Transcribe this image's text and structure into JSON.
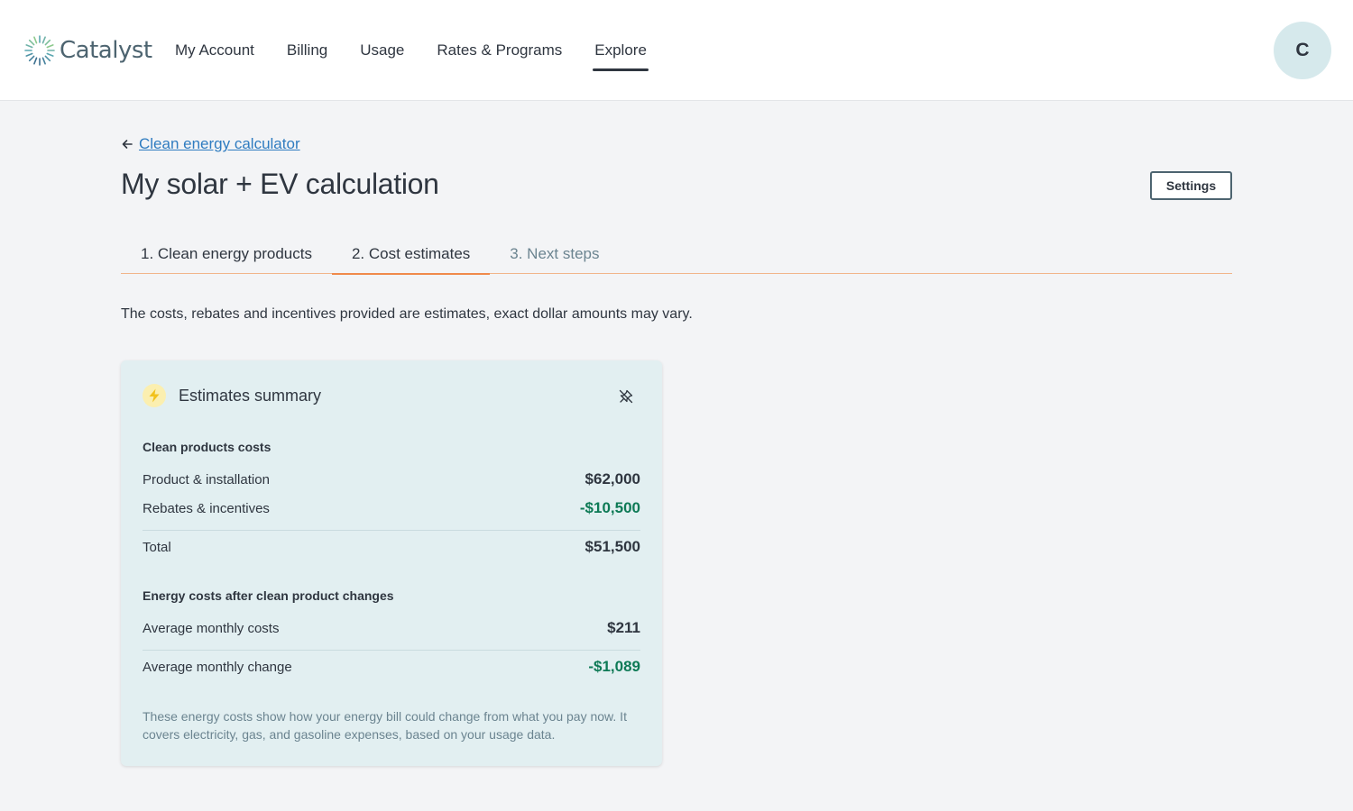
{
  "header": {
    "logo_text": "Catalyst",
    "nav": [
      {
        "label": "My Account"
      },
      {
        "label": "Billing"
      },
      {
        "label": "Usage"
      },
      {
        "label": "Rates & Programs"
      },
      {
        "label": "Explore"
      }
    ],
    "active_nav": "Explore",
    "avatar_initial": "C"
  },
  "breadcrumb": {
    "back_label": "Clean energy calculator"
  },
  "page": {
    "title": "My solar + EV calculation",
    "settings_label": "Settings",
    "disclaimer": "The costs, rebates and incentives provided are estimates, exact dollar amounts may vary."
  },
  "tabs": [
    {
      "label": "1. Clean energy products"
    },
    {
      "label": "2. Cost estimates"
    },
    {
      "label": "3. Next steps"
    }
  ],
  "active_tab": "2. Cost estimates",
  "summary": {
    "title": "Estimates summary",
    "clean_costs": {
      "title": "Clean products costs",
      "product_label": "Product & installation",
      "product_value": "$62,000",
      "rebates_label": "Rebates & incentives",
      "rebates_value": "-$10,500",
      "total_label": "Total",
      "total_value": "$51,500"
    },
    "energy_costs": {
      "title": "Energy costs after clean product changes",
      "avg_monthly_label": "Average monthly costs",
      "avg_monthly_value": "$211",
      "avg_change_label": "Average monthly change",
      "avg_change_value": "-$1,089"
    },
    "footnote": "These energy costs show how your energy bill could change from what you pay now. It covers electricity, gas, and gasoline expenses, based on your usage data."
  },
  "colors": {
    "accent_tab": "#f08a4b",
    "link": "#2f7cc0",
    "negative_value": "#0e7a56",
    "card_bg": "#e2eff1"
  },
  "icons": [
    "catalyst-logo-icon",
    "arrow-left-icon",
    "lightning-bolt-icon",
    "unpin-icon"
  ]
}
